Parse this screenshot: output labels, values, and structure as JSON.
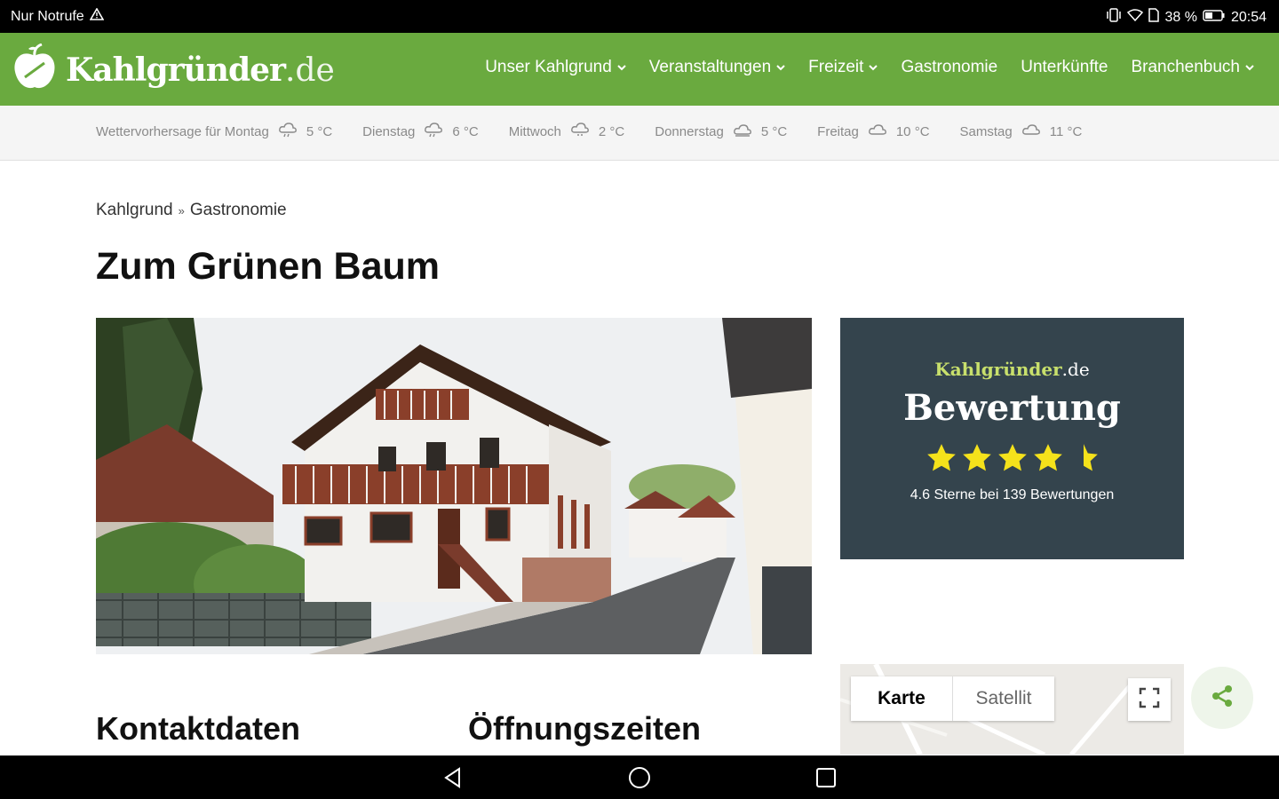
{
  "status_bar": {
    "carrier": "Nur Notrufe",
    "battery": "38 %",
    "time": "20:54"
  },
  "site": {
    "brand": "Kahlgründer",
    "tld": ".de",
    "brand_color": "#6aaa3f"
  },
  "nav": {
    "items": [
      {
        "label": "Unser Kahlgrund",
        "dropdown": true
      },
      {
        "label": "Veranstaltungen",
        "dropdown": true
      },
      {
        "label": "Freizeit",
        "dropdown": true
      },
      {
        "label": "Gastronomie",
        "dropdown": false
      },
      {
        "label": "Unterkünfte",
        "dropdown": false
      },
      {
        "label": "Branchenbuch",
        "dropdown": true
      }
    ]
  },
  "weather": {
    "days": [
      {
        "day": "Wettervorhersage für Montag",
        "temp": "5 °C",
        "icon": "cloud-rain-icon"
      },
      {
        "day": "Dienstag",
        "temp": "6 °C",
        "icon": "cloud-rain-icon"
      },
      {
        "day": "Mittwoch",
        "temp": "2 °C",
        "icon": "cloud-snow-icon"
      },
      {
        "day": "Donnerstag",
        "temp": "5 °C",
        "icon": "cloud-sun-icon"
      },
      {
        "day": "Freitag",
        "temp": "10 °C",
        "icon": "cloud-icon"
      },
      {
        "day": "Samstag",
        "temp": "11 °C",
        "icon": "cloud-icon"
      }
    ]
  },
  "breadcrumb": {
    "root": "Kahlgrund",
    "separator": "»",
    "current": "Gastronomie"
  },
  "page": {
    "title": "Zum Grünen Baum"
  },
  "rating_card": {
    "brand": "Kahlgründer",
    "tld": ".de",
    "heading": "Bewertung",
    "stars": 4.6,
    "summary": "4.6 Sterne bei 139 Bewertungen",
    "bg_color": "#34444d",
    "star_color": "#f5e21b"
  },
  "map": {
    "tab_map": "Karte",
    "tab_satellite": "Satellit"
  },
  "sections": {
    "contact": "Kontaktdaten",
    "opening_hours": "Öffnungszeiten"
  }
}
